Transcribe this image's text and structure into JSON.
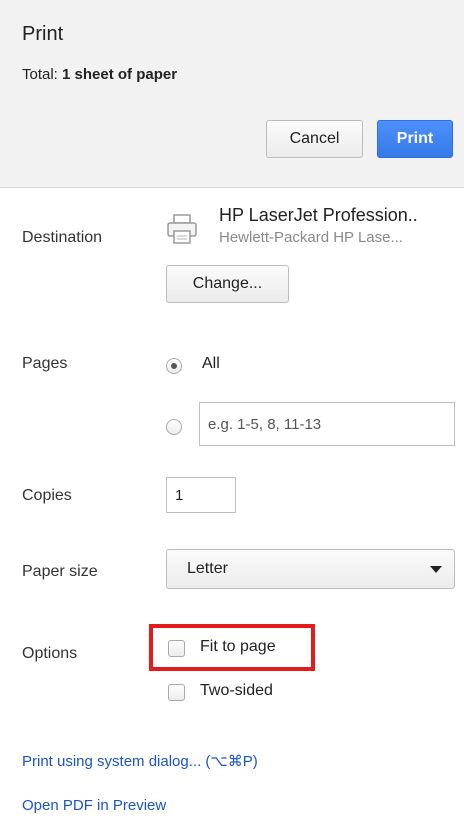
{
  "header": {
    "title": "Print",
    "total_label": "Total:",
    "total_value": "1 sheet of paper",
    "cancel_label": "Cancel",
    "print_label": "Print"
  },
  "destination": {
    "label": "Destination",
    "printer_name": "HP LaserJet Profession..",
    "printer_model": "Hewlett-Packard HP Lase...",
    "change_label": "Change..."
  },
  "pages": {
    "label": "Pages",
    "option_all": "All",
    "all_selected": true,
    "range_placeholder": "e.g. 1-5, 8, 11-13"
  },
  "copies": {
    "label": "Copies",
    "value": "1"
  },
  "paper_size": {
    "label": "Paper size",
    "selected": "Letter"
  },
  "options": {
    "label": "Options",
    "fit_to_page": "Fit to page",
    "fit_to_page_checked": false,
    "two_sided": "Two-sided",
    "two_sided_checked": false
  },
  "links": {
    "system_dialog": "Print using system dialog... (⌥⌘P)",
    "open_pdf": "Open PDF in Preview"
  },
  "colors": {
    "primary_button": "#4d90fe",
    "link": "#1a55c4",
    "highlight": "#e31b1b",
    "header_bg": "#f2f2f2"
  }
}
